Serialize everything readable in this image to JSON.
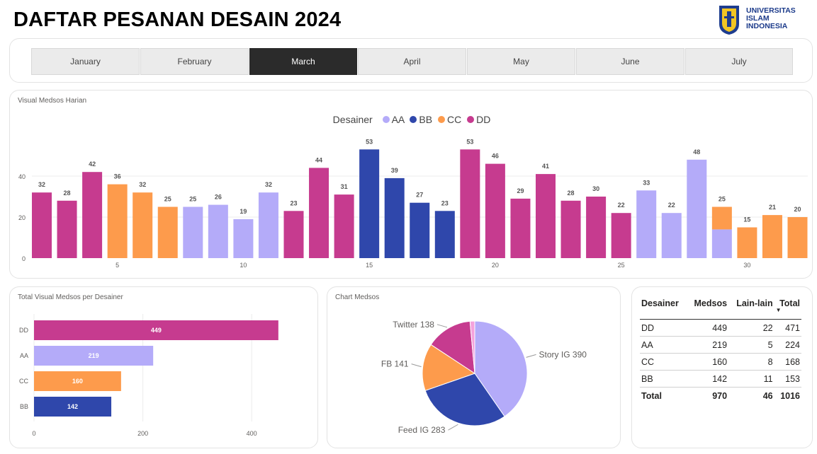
{
  "header": {
    "title": "DAFTAR PESANAN DESAIN 2024"
  },
  "logo": {
    "line1": "UNIVERSITAS",
    "line2": "ISLAM",
    "line3": "INDONESIA"
  },
  "months": [
    "January",
    "February",
    "March",
    "April",
    "May",
    "June",
    "July"
  ],
  "active_month": "March",
  "colors": {
    "AA": "#b4abf9",
    "BB": "#2f47ab",
    "CC": "#fd9b4c",
    "DD": "#c63b8f",
    "pink": "#f4a2dc"
  },
  "daily_card": {
    "title": "Visual Medsos Harian"
  },
  "bar_card": {
    "title": "Total Visual Medsos per Desainer"
  },
  "pie_card": {
    "title": "Chart Medsos"
  },
  "chart_data": [
    {
      "type": "bar",
      "title": "Visual Medsos Harian",
      "legend_title": "Desainer",
      "legend": [
        "AA",
        "BB",
        "CC",
        "DD"
      ],
      "legend_position": "top-center",
      "x": [
        2,
        3,
        4,
        5,
        6,
        7,
        8,
        9,
        10,
        11,
        12,
        13,
        14,
        15,
        16,
        17,
        18,
        19,
        20,
        21,
        22,
        23,
        24,
        25,
        26,
        27,
        28,
        29,
        30,
        31
      ],
      "x_ticks": [
        5,
        10,
        15,
        20,
        25,
        30
      ],
      "y_ticks": [
        0,
        20,
        40
      ],
      "ylim": [
        0,
        60
      ],
      "grid": true,
      "values": [
        32,
        28,
        42,
        36,
        32,
        25,
        25,
        26,
        19,
        32,
        23,
        44,
        31,
        53,
        39,
        27,
        23,
        53,
        46,
        29,
        41,
        28,
        30,
        22,
        33,
        22,
        48,
        25,
        15,
        21,
        20
      ],
      "bars": [
        {
          "x": 2,
          "designer": "DD",
          "value": 32
        },
        {
          "x": 3,
          "designer": "DD",
          "value": 28
        },
        {
          "x": 4,
          "designer": "DD",
          "value": 42
        },
        {
          "x": 5,
          "designer": "CC",
          "value": 36
        },
        {
          "x": 6,
          "designer": "CC",
          "value": 32
        },
        {
          "x": 7,
          "designer": "CC",
          "value": 25
        },
        {
          "x": 8,
          "designer": "AA",
          "value": 25
        },
        {
          "x": 9,
          "designer": "AA",
          "value": 26
        },
        {
          "x": 10,
          "designer": "AA",
          "value": 19
        },
        {
          "x": 11,
          "designer": "AA",
          "value": 32
        },
        {
          "x": 12,
          "designer": "DD",
          "value": 23
        },
        {
          "x": 13,
          "designer": "DD",
          "value": 44
        },
        {
          "x": 14,
          "designer": "DD",
          "value": 31
        },
        {
          "x": 15,
          "designer": "BB",
          "value": 53
        },
        {
          "x": 16,
          "designer": "BB",
          "value": 39
        },
        {
          "x": 17,
          "designer": "BB",
          "value": 27
        },
        {
          "x": 18,
          "designer": "BB",
          "value": 23
        },
        {
          "x": 19,
          "designer": "DD",
          "value": 53
        },
        {
          "x": 20,
          "designer": "DD",
          "value": 46
        },
        {
          "x": 21,
          "designer": "DD",
          "value": 29
        },
        {
          "x": 22,
          "designer": "DD",
          "value": 41
        },
        {
          "x": 23,
          "designer": "DD",
          "value": 28
        },
        {
          "x": 24,
          "designer": "DD",
          "value": 30
        },
        {
          "x": 25,
          "designer": "DD",
          "value": 22
        },
        {
          "x": 26,
          "designer": "AA",
          "value": 33
        },
        {
          "x": 27,
          "designer": "AA",
          "value": 22
        },
        {
          "x": 28,
          "designer": "AA",
          "value": 48
        },
        {
          "x": 29,
          "designer": "CC",
          "value": 25,
          "stack": [
            {
              "designer": "AA",
              "value": 14
            },
            {
              "designer": "CC",
              "value": 11
            }
          ]
        },
        {
          "x": 30,
          "designer": "CC",
          "value": 15
        },
        {
          "x": 31,
          "designer": "CC",
          "value": 21
        },
        {
          "x": 32,
          "designer": "CC",
          "value": 20
        }
      ]
    },
    {
      "type": "bar",
      "orientation": "horizontal",
      "title": "Total Visual Medsos per Desainer",
      "categories": [
        "DD",
        "AA",
        "CC",
        "BB"
      ],
      "values": [
        449,
        219,
        160,
        142
      ],
      "x_ticks": [
        0,
        200,
        400
      ],
      "xlim": [
        0,
        500
      ]
    },
    {
      "type": "pie",
      "title": "Chart Medsos",
      "labels": [
        "Story IG",
        "Feed IG",
        "FB",
        "Twitter",
        "Lain-lain"
      ],
      "values": [
        390,
        283,
        141,
        138,
        14
      ],
      "label_text": [
        "Story IG 390",
        "Feed IG 283",
        "FB 141",
        "Twitter 138"
      ]
    }
  ],
  "table": {
    "headers": [
      "Desainer",
      "Medsos",
      "Lain-lain",
      "Total"
    ],
    "sort_indicator": "▼",
    "rows": [
      [
        "DD",
        "449",
        "22",
        "471"
      ],
      [
        "AA",
        "219",
        "5",
        "224"
      ],
      [
        "CC",
        "160",
        "8",
        "168"
      ],
      [
        "BB",
        "142",
        "11",
        "153"
      ]
    ],
    "total_row": [
      "Total",
      "970",
      "46",
      "1016"
    ]
  }
}
